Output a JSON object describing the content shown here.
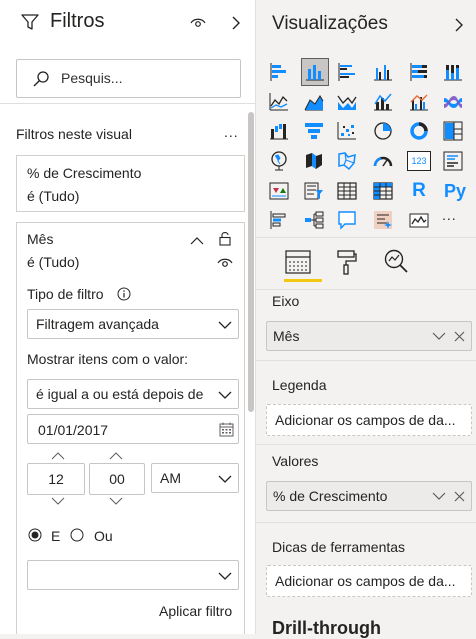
{
  "filters": {
    "title": "Filtros",
    "search_placeholder": "Pesquis...",
    "section_label": "Filtros neste visual",
    "more_dots": "...",
    "card1": {
      "field": "% de Crescimento",
      "state": "é (Tudo)"
    },
    "card2": {
      "field": "Mês",
      "state": "é (Tudo)",
      "filter_type_label": "Tipo de filtro",
      "filter_type_value": "Filtragem avançada",
      "show_items_label": "Mostrar itens com o valor:",
      "condition_value": "é igual a ou está depois de",
      "date_value": "01/01/2017",
      "hour": "12",
      "minute": "00",
      "ampm": "AM",
      "and_label": "E",
      "or_label": "Ou",
      "apply_label": "Aplicar filtro"
    }
  },
  "viz": {
    "title": "Visualizações",
    "more_dots": "...",
    "wells": {
      "axis_label": "Eixo",
      "axis_value": "Mês",
      "legend_label": "Legenda",
      "legend_placeholder": "Adicionar os campos de da...",
      "values_label": "Valores",
      "values_value": "% de Crescimento",
      "tooltips_label": "Dicas de ferramentas",
      "tooltips_placeholder": "Adicionar os campos de da...",
      "drill_label": "Drill-through"
    },
    "text_icons": {
      "r": "R",
      "py": "Py",
      "kpi": "123"
    }
  },
  "colors": {
    "accent": "#f2c811",
    "icon_blue": "#118dff",
    "icon_dark": "#252423"
  }
}
